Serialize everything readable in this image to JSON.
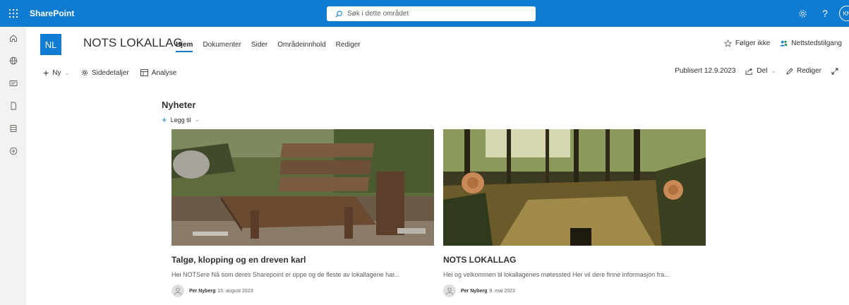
{
  "topbar": {
    "app_name": "SharePoint",
    "search_placeholder": "Søk i dette området",
    "user_initials": "KN",
    "help_label": "?"
  },
  "header": {
    "logo_initials": "NL",
    "site_title": "NOTS LOKALLAG",
    "tabs": [
      {
        "label": "Hjem",
        "active": true
      },
      {
        "label": "Dokumenter",
        "active": false
      },
      {
        "label": "Sider",
        "active": false
      },
      {
        "label": "Områdeinnhold",
        "active": false
      },
      {
        "label": "Rediger",
        "active": false
      }
    ],
    "follow_label": "Følger ikke",
    "access_label": "Nettstedstilgang"
  },
  "commandbar": {
    "new_label": "Ny",
    "details_label": "Sidedetaljer",
    "analytics_label": "Analyse",
    "published_label": "Publisert 12.9.2023",
    "share_label": "Del",
    "edit_label": "Rediger"
  },
  "news": {
    "title": "Nyheter",
    "add_label": "Legg til",
    "items": [
      {
        "title": "Talgø, klopping og en dreven karl",
        "excerpt": "Hei NOTSere Nå som deres Sharepoint er oppe og de fleste av lokallagene har...",
        "author": "Per Nyberg",
        "date": "15. august 2023"
      },
      {
        "title": "NOTS LOKALLAG",
        "excerpt": "Hei og velkommen til lokallagenes møtessted Her vil dere finne informasjon fra...",
        "author": "Per Nyberg",
        "date": "9. mai 2023"
      }
    ]
  },
  "colors": {
    "brand": "#0f7bd1",
    "rail": "#f3f2f1"
  }
}
